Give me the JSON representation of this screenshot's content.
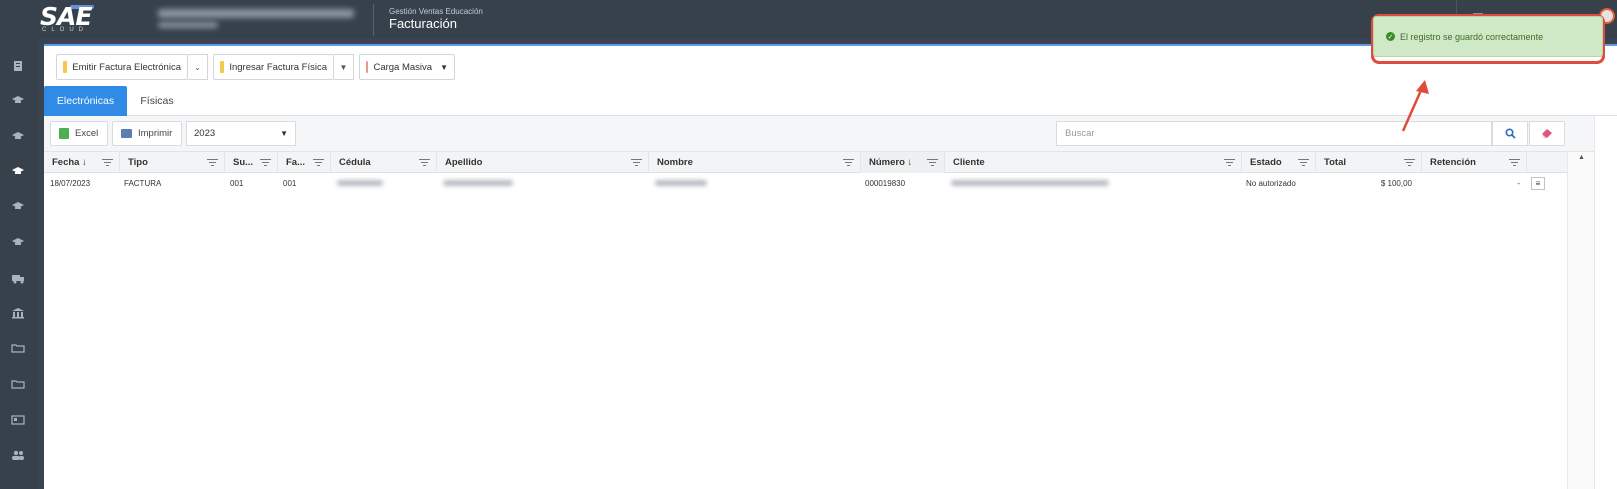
{
  "app": {
    "logo_text": "SAE",
    "logo_sub": "CLOUD",
    "module_sub": "Gestión Ventas Educación",
    "module_title": "Facturación"
  },
  "toolbar": {
    "emit_label": "Emitir Factura Electrónica",
    "ingresar_label": "Ingresar Factura Física",
    "carga_label": "Carga Masiva"
  },
  "tabs": [
    {
      "label": "Electrónicas",
      "active": true
    },
    {
      "label": "Físicas",
      "active": false
    }
  ],
  "grid_toolbar": {
    "excel_label": "Excel",
    "print_label": "Imprimir",
    "year_value": "2023",
    "search_placeholder": "Buscar"
  },
  "table": {
    "columns": [
      "Fecha ↓",
      "Tipo",
      "Su...",
      "Fa...",
      "Cédula",
      "Apellido",
      "Nombre",
      "Número ↓",
      "Cliente",
      "Estado",
      "Total",
      "Retención"
    ],
    "rows": [
      {
        "fecha": "18/07/2023",
        "tipo": "FACTURA",
        "su": "001",
        "fa": "001",
        "numero": "000019830",
        "estado": "No autorizado",
        "total": "$ 100,00",
        "retencion": "-"
      }
    ]
  },
  "toast": {
    "message": "El registro se guardó correctamente"
  },
  "colors": {
    "accent": "#2f8be6",
    "topbar": "#37414c",
    "toast_bg": "#cfe8c5",
    "highlight": "#e04c3c"
  },
  "icons": [
    "document-icon",
    "graduation-cap-icon",
    "truck-icon",
    "bank-icon",
    "folder-icon",
    "id-card-icon",
    "users-icon",
    "search-icon",
    "eraser-icon",
    "check-icon",
    "menu-icon"
  ]
}
